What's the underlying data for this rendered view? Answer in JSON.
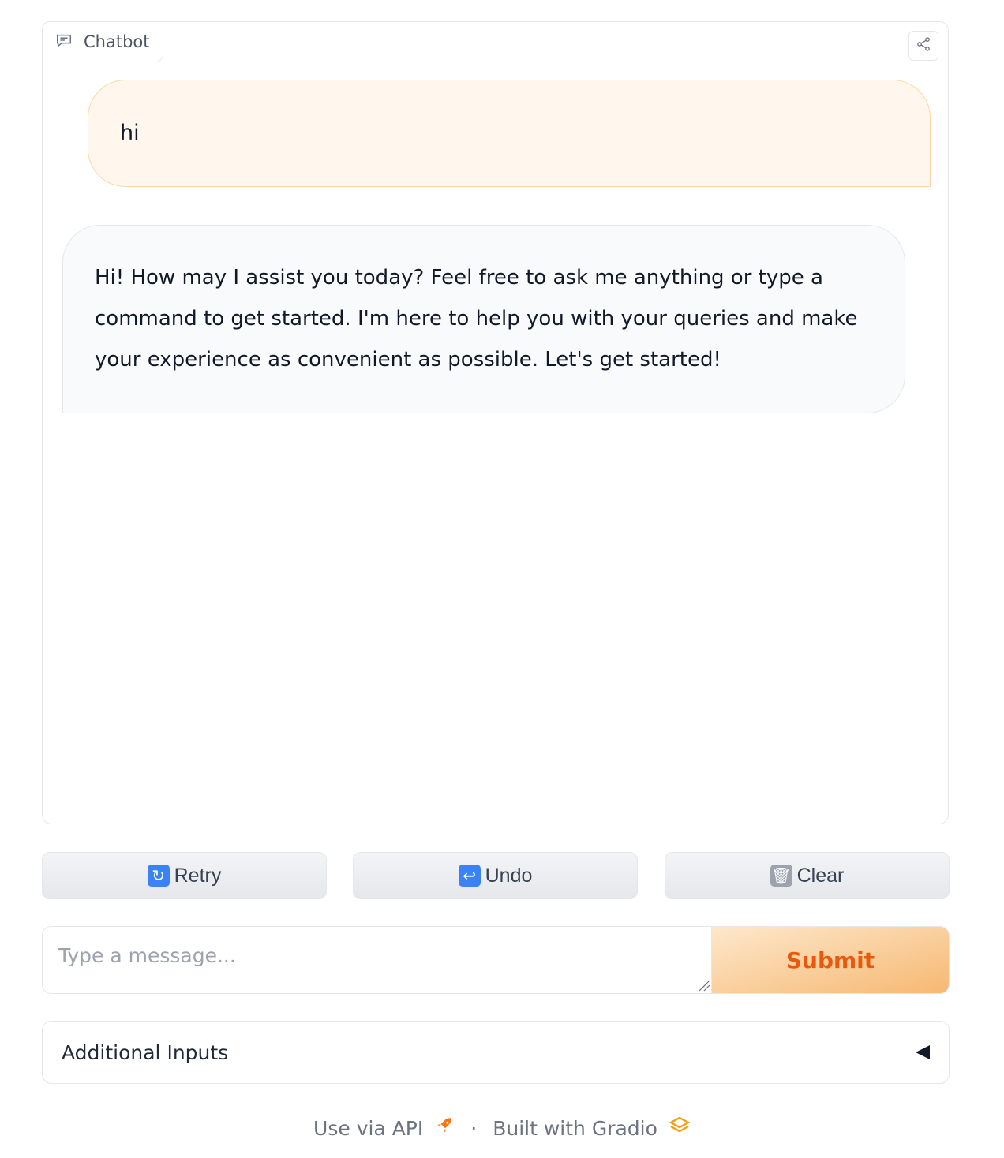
{
  "chatbot": {
    "label": "Chatbot",
    "messages": [
      {
        "role": "user",
        "text": "hi"
      },
      {
        "role": "bot",
        "text": "Hi! How may I assist you today? Feel free to ask me anything or type a command to get started. I'm here to help you with your queries and make your experience as convenient as possible. Let's get started!"
      }
    ]
  },
  "actions": {
    "retry_label": "Retry",
    "undo_label": "Undo",
    "clear_label": "Clear"
  },
  "input": {
    "value": "",
    "placeholder": "Type a message...",
    "submit_label": "Submit"
  },
  "accordion": {
    "label": "Additional Inputs"
  },
  "footer": {
    "api_label": "Use via API",
    "separator": "·",
    "built_label": "Built with Gradio"
  },
  "colors": {
    "accent": "#ea580c",
    "user_bubble_bg": "#fff7ed",
    "user_bubble_border": "#fbd8a5",
    "bot_bubble_bg": "#f9fafb"
  }
}
